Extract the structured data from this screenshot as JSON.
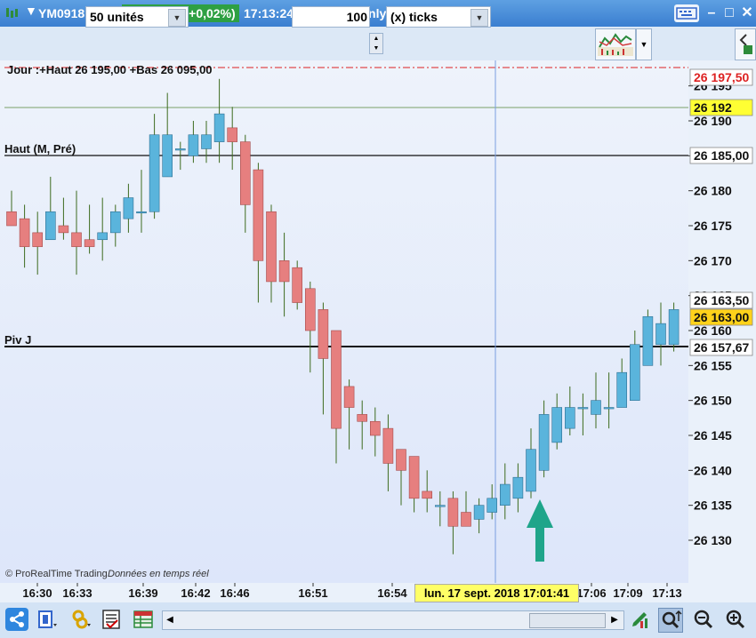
{
  "window": {
    "symbol": "YM0918",
    "price_badge": "26 163,00 (+0,02%)",
    "info": "17:13:24 Mini DJ30 Only0918"
  },
  "toolbar": {
    "units_value": "50 unités",
    "ticks_count": "100",
    "ticks_unit": "(x) ticks"
  },
  "chart": {
    "top_label": "Jour :+Haut 26 195,00 +Bas 26 095,00",
    "hline_high_label": "Haut (M, Pré)",
    "hline_pivot_label": "Piv J",
    "watermark": "© ProRealTime Trading",
    "data_note": "Données en temps réel",
    "price_tags": {
      "red": "26 197,50",
      "yellow": "26 192",
      "high": "26 185,00",
      "p1": "26 163,50",
      "current": "26 163,00",
      "pivot": "26 157,67"
    },
    "crosshair_time": "lun. 17 sept. 2018 17:01:41"
  },
  "chart_data": {
    "type": "candlestick",
    "y_ticks": [
      "26 130",
      "26 135",
      "26 140",
      "26 145",
      "26 150",
      "26 155",
      "26 160",
      "26 165",
      "26 170",
      "26 175",
      "26 180",
      "26 185",
      "26 190",
      "26 195"
    ],
    "y_range": [
      26126,
      26197.5
    ],
    "x_ticks": [
      "16:30",
      "16:33",
      "16:39",
      "16:42",
      "16:46",
      "16:51",
      "16:54",
      "17:06",
      "17:09",
      "17:13"
    ],
    "candles": [
      {
        "o": 26177,
        "h": 26180,
        "l": 26175,
        "c": 26175
      },
      {
        "o": 26176,
        "h": 26178,
        "l": 26169,
        "c": 26172
      },
      {
        "o": 26174,
        "h": 26177,
        "l": 26168,
        "c": 26172
      },
      {
        "o": 26173,
        "h": 26182,
        "l": 26173,
        "c": 26177
      },
      {
        "o": 26175,
        "h": 26179,
        "l": 26173,
        "c": 26174
      },
      {
        "o": 26174,
        "h": 26180,
        "l": 26168,
        "c": 26172
      },
      {
        "o": 26173,
        "h": 26178,
        "l": 26171,
        "c": 26172
      },
      {
        "o": 26173,
        "h": 26179,
        "l": 26170,
        "c": 26174
      },
      {
        "o": 26174,
        "h": 26178,
        "l": 26172,
        "c": 26177
      },
      {
        "o": 26176,
        "h": 26181,
        "l": 26174,
        "c": 26179
      },
      {
        "o": 26177,
        "h": 26183,
        "l": 26174,
        "c": 26177
      },
      {
        "o": 26177,
        "h": 26191,
        "l": 26176,
        "c": 26188
      },
      {
        "o": 26182,
        "h": 26194,
        "l": 26182,
        "c": 26188
      },
      {
        "o": 26186,
        "h": 26187,
        "l": 26183,
        "c": 26186
      },
      {
        "o": 26185,
        "h": 26190,
        "l": 26184,
        "c": 26188
      },
      {
        "o": 26186,
        "h": 26190,
        "l": 26184,
        "c": 26188
      },
      {
        "o": 26187,
        "h": 26196,
        "l": 26184,
        "c": 26191
      },
      {
        "o": 26189,
        "h": 26192,
        "l": 26183,
        "c": 26187
      },
      {
        "o": 26187,
        "h": 26188,
        "l": 26174,
        "c": 26178
      },
      {
        "o": 26183,
        "h": 26184,
        "l": 26164,
        "c": 26170
      },
      {
        "o": 26177,
        "h": 26178,
        "l": 26164,
        "c": 26167
      },
      {
        "o": 26170,
        "h": 26174,
        "l": 26162,
        "c": 26167
      },
      {
        "o": 26169,
        "h": 26170,
        "l": 26163,
        "c": 26164
      },
      {
        "o": 26166,
        "h": 26167,
        "l": 26154,
        "c": 26160
      },
      {
        "o": 26163,
        "h": 26164,
        "l": 26148,
        "c": 26156
      },
      {
        "o": 26160,
        "h": 26160,
        "l": 26141,
        "c": 26146
      },
      {
        "o": 26152,
        "h": 26153,
        "l": 26143,
        "c": 26149
      },
      {
        "o": 26148,
        "h": 26150,
        "l": 26143,
        "c": 26147
      },
      {
        "o": 26147,
        "h": 26149,
        "l": 26142,
        "c": 26145
      },
      {
        "o": 26146,
        "h": 26148,
        "l": 26137,
        "c": 26141
      },
      {
        "o": 26143,
        "h": 26143,
        "l": 26135,
        "c": 26140
      },
      {
        "o": 26142,
        "h": 26142,
        "l": 26134,
        "c": 26136
      },
      {
        "o": 26137,
        "h": 26140,
        "l": 26134,
        "c": 26136
      },
      {
        "o": 26135,
        "h": 26137,
        "l": 26132,
        "c": 26135
      },
      {
        "o": 26136,
        "h": 26137,
        "l": 26128,
        "c": 26132
      },
      {
        "o": 26134,
        "h": 26137,
        "l": 26132,
        "c": 26132
      },
      {
        "o": 26133,
        "h": 26136,
        "l": 26131,
        "c": 26135
      },
      {
        "o": 26134,
        "h": 26138,
        "l": 26133,
        "c": 26136
      },
      {
        "o": 26135,
        "h": 26141,
        "l": 26133,
        "c": 26138
      },
      {
        "o": 26136,
        "h": 26141,
        "l": 26134,
        "c": 26139
      },
      {
        "o": 26137,
        "h": 26146,
        "l": 26136,
        "c": 26143
      },
      {
        "o": 26140,
        "h": 26150,
        "l": 26139,
        "c": 26148
      },
      {
        "o": 26144,
        "h": 26151,
        "l": 26143,
        "c": 26149
      },
      {
        "o": 26146,
        "h": 26152,
        "l": 26145,
        "c": 26149
      },
      {
        "o": 26149,
        "h": 26151,
        "l": 26145,
        "c": 26149
      },
      {
        "o": 26148,
        "h": 26154,
        "l": 26146,
        "c": 26150
      },
      {
        "o": 26149,
        "h": 26154,
        "l": 26146,
        "c": 26149
      },
      {
        "o": 26149,
        "h": 26156,
        "l": 26149,
        "c": 26154
      },
      {
        "o": 26150,
        "h": 26160,
        "l": 26150,
        "c": 26158
      },
      {
        "o": 26155,
        "h": 26163,
        "l": 26155,
        "c": 26162
      },
      {
        "o": 26158,
        "h": 26164,
        "l": 26155,
        "c": 26161
      },
      {
        "o": 26158,
        "h": 26164,
        "l": 26157,
        "c": 26163
      }
    ],
    "hlines": [
      {
        "name": "Haut (M, Pré)",
        "value": 26185
      },
      {
        "name": "Piv J",
        "value": 26157.67
      },
      {
        "name": "Jour Haut",
        "value": 26197.5
      },
      {
        "name": "Yellow",
        "value": 26192
      }
    ],
    "colors": {
      "up": "#5ab4dc",
      "down": "#e67f7f",
      "wick": "#3d6b1f",
      "bg": "#dfe8fa",
      "arrow": "#1fa58a"
    }
  },
  "bottombar": {
    "icons": [
      "share-icon",
      "window-icon",
      "tools-icon",
      "list-icon",
      "table-icon",
      "pencil-icon",
      "zoom-fit-icon",
      "zoom-out-icon",
      "zoom-in-icon"
    ]
  }
}
